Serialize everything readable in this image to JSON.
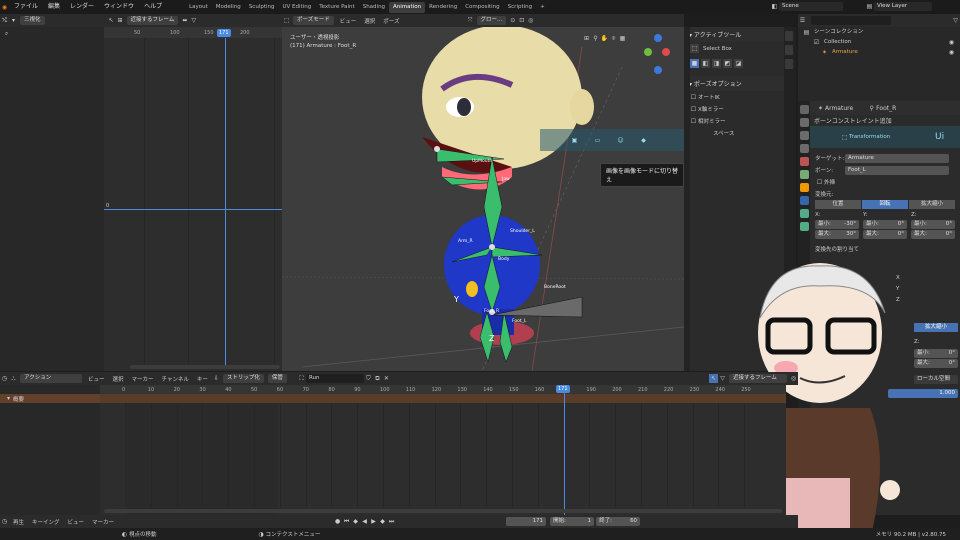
{
  "topbar": {
    "menus": [
      "ファイル",
      "編集",
      "レンダー",
      "ウィンドウ",
      "ヘルプ"
    ],
    "workspaces": [
      "Layout",
      "Modeling",
      "Sculpting",
      "UV Editing",
      "Texture Paint",
      "Shading",
      "Animation",
      "Rendering",
      "Compositing",
      "Scripting",
      "+"
    ],
    "active_workspace": "Animation",
    "scene": "Scene",
    "view_layer": "View Layer"
  },
  "left_editor": {
    "view_label": "三視化",
    "snap_label": "近接するフレーム",
    "ticks": [
      "50",
      "100",
      "150",
      "171",
      "200"
    ],
    "current_frame": "171",
    "y_ticks": [
      "0"
    ]
  },
  "viewport": {
    "mode": "ポーズモード",
    "menus": [
      "ビュー",
      "選択",
      "ポーズ"
    ],
    "orientation": "グロー...",
    "view_name": "ユーザー・透視投影",
    "object_info": "(171) Armature : Foot_R",
    "tooltip": "画像を画像モードに切り替え",
    "bone_labels": [
      "Head",
      "UpMouth",
      "Jaw",
      "Neck",
      "Shoulder_L",
      "Shoulder_R",
      "Arm_R",
      "Body",
      "BoneRoot",
      "Foot_R",
      "Foot_L"
    ],
    "axis_y": "Y",
    "axis_z": "Z"
  },
  "active_tool": {
    "title": "アクティブツール",
    "tool": "Select Box",
    "pose_options_title": "ポーズオプション",
    "options": [
      "オートIK",
      "X軸ミラー",
      "相対ミラー"
    ],
    "space_label": "スペース"
  },
  "outliner": {
    "title": "シーンコレクション",
    "rows": [
      "Collection",
      "Armature"
    ]
  },
  "properties": {
    "object": "Armature",
    "bone": "Foot_R",
    "add_constraint": "ボーンコンストレイント追加",
    "constraint_name": "Transformation",
    "target_label": "ターゲット:",
    "target": "Armature",
    "bone_label": "ボーン:",
    "bone_value": "Foot_L",
    "extrapolate": "外挿",
    "map_from_label": "変換元:",
    "map_from": [
      "位置",
      "回転",
      "拡大縮小"
    ],
    "active_map_from": "回転",
    "x_label": "X:",
    "y_label": "Y:",
    "z_label": "Z:",
    "min_label": "最小:",
    "max_label": "最大:",
    "x_min": "-30°",
    "x_max": "30°",
    "y_min": "0°",
    "y_max": "0°",
    "z_min": "0°",
    "z_max": "0°",
    "map_to_label": "変換先の割り当て",
    "map_to_axes": [
      "X",
      "Y",
      "Z"
    ],
    "scale_btn": "拡大縮小",
    "z_min2": "0°",
    "z_max2": "0°",
    "space": "ローカル空間",
    "influence": "1.000"
  },
  "dopesheet": {
    "mode": "アクション",
    "menus": [
      "ビュー",
      "選択",
      "マーカー",
      "チャンネル",
      "キー"
    ],
    "strip_btn": "ストリップ化",
    "save_btn": "保管",
    "action": "Run",
    "snap": "近接するフレーム",
    "summary": "概要",
    "ticks": [
      "0",
      "10",
      "20",
      "30",
      "40",
      "50",
      "60",
      "70",
      "80",
      "90",
      "100",
      "110",
      "120",
      "130",
      "140",
      "150",
      "160",
      "171",
      "190",
      "200",
      "210",
      "220",
      "230",
      "240",
      "250"
    ],
    "current_frame": "171"
  },
  "timeline": {
    "menus": [
      "再生",
      "キーイング",
      "ビュー",
      "マーカー"
    ],
    "current_frame": "171",
    "start_label": "開始:",
    "start": "1",
    "end_label": "終了:",
    "end": "60"
  },
  "statusbar": {
    "left": "視点の移動",
    "middle": "コンテクストメニュー",
    "right": "メモリ 90.2 MB | v2.80.75"
  }
}
